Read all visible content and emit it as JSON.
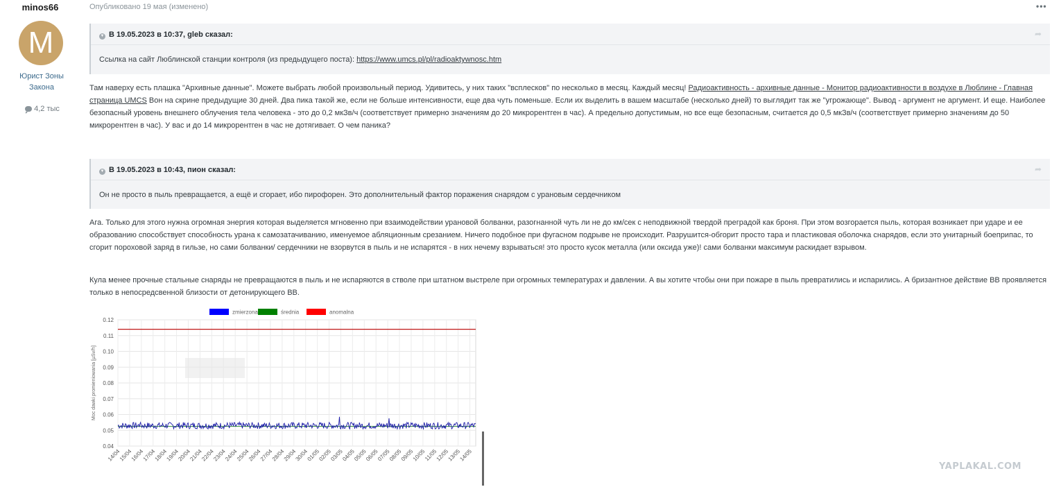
{
  "author": {
    "name": "minos66",
    "avatar_letter": "M",
    "title_line1": "Юрист Зоны",
    "title_line2": "Закона",
    "reputation": "4,2 тыс"
  },
  "post": {
    "meta": "Опубликовано 19 мая (изменено)",
    "more_menu": "•••"
  },
  "quotes": [
    {
      "header": "В 19.05.2023 в 10:37, gleb сказал:",
      "body_text": "Ссылка на сайт Люблинской станции контроля (из предыдущего поста): ",
      "body_link": "https://www.umcs.pl/pl/radioaktywnosc.htm"
    },
    {
      "header": "В 19.05.2023 в 10:43, пион сказал:",
      "body_text": "Он не просто в пыль превращается, а ещё и сгорает, ибо пирофорен. Это дополнительный фактор поражения снарядом с урановым сердечником"
    }
  ],
  "reply1": {
    "lead": " Там наверху есть плашка \"Архивные данные\". Можете выбрать любой произвольный период. Удивитесь, у них  таких \"всплесков\" по несколько в месяц. Каждый месяц! ",
    "link": "Радиоактивность - архивные данные - Монитор радиоактивности в воздухе в Люблине - Главная страница UMCS",
    "tail": "  Вон на скрине предыдущие 30 дней. Два пика такой же, если не больше интенсивности, еще два чуть поменьше. Если их выделить в вашем масштабе (несколько дней) то выглядит так же \"угрожающе\". Вывод - аргумент не аргумент. И еще. Наиболее безопасный уровень внешнего облучения тела человека - это до 0,2 мкЗв/ч (соответствует примерно значениям до 20 микрорентген в час). А предельно допустимым, но все еще безопасным, считается  до 0,5 мкЗв/ч (соответствует примерно значениям до 50 микрорентген в час). У вас и до 14 микрорентген в час не дотягивает. О чем паника?"
  },
  "reply2": {
    "p1": "Ага. Только для этого нужна огромная энергия которая выделяется мгновенно при взаимодействии урановой болванки, разогнанной чуть ли не до км/сек с неподвижной твердой преградой как броня. При этом возгорается пыль, которая возникает при ударе и ее образованию способствует  способность урана к самозатачиванию, именуемое абляционным срезанием. Ничего подобное при фугасном подрыве не происходит. Разрушится-обгорит просто тара и пластиковая оболочка снарядов, если это унитарный боеприпас, то сгорит пороховой заряд в гильзе, но сами болванки/ сердечники не взорвутся в пыль и не испарятся - в них нечему взрываться! это просто кусок металла (или оксида уже)! сами болванки максимум раскидает взрывом.",
    "p2": "Кула менее прочные стальные снаряды не превращаются  в пыль и не испаряются в стволе при штатном выстреле при огромных температурах и давлении. А вы хотите чтобы они при пожаре в пыль превратились и испарились.  А бризантное действие ВВ проявляется только в непосредсвенной близости от детонирующего ВВ."
  },
  "chart_data": {
    "type": "line",
    "legend_placement": "top",
    "series": [
      {
        "name": "zmierzona",
        "color": "#0000ff"
      },
      {
        "name": "średnia",
        "color": "#008000"
      },
      {
        "name": "anomalna",
        "color": "#ff0000"
      }
    ],
    "ylabel": "Moc dawki promieniowania [µSv/h]",
    "ylim": [
      0.04,
      0.12
    ],
    "yticks": [
      "0.12",
      "0.11",
      "0.10",
      "0.09",
      "0.08",
      "0.07",
      "0.06",
      "0.05",
      "0.04"
    ],
    "x_ticks": [
      "14/04",
      "15/04",
      "16/04",
      "17/04",
      "18/04",
      "19/04",
      "20/04",
      "21/04",
      "22/04",
      "23/04",
      "24/04",
      "25/04",
      "26/04",
      "27/04",
      "28/04",
      "29/04",
      "30/04",
      "01/05",
      "02/05",
      "03/05",
      "04/05",
      "05/05",
      "06/05",
      "07/05",
      "08/05",
      "09/05",
      "10/05",
      "11/05",
      "12/05",
      "13/05",
      "14/05"
    ],
    "anomaly_threshold": 0.114,
    "mean_level": 0.0525,
    "baseline": 0.053,
    "peaks": [
      {
        "day": 1.9,
        "value": 0.067
      },
      {
        "day": 11.0,
        "value": 0.0595
      },
      {
        "day": 18.9,
        "value": 0.065
      },
      {
        "day": 23.1,
        "value": 0.0605
      }
    ],
    "x_range_days": [
      0,
      30.5
    ]
  },
  "watermark": "YAPLAKAL.COM"
}
